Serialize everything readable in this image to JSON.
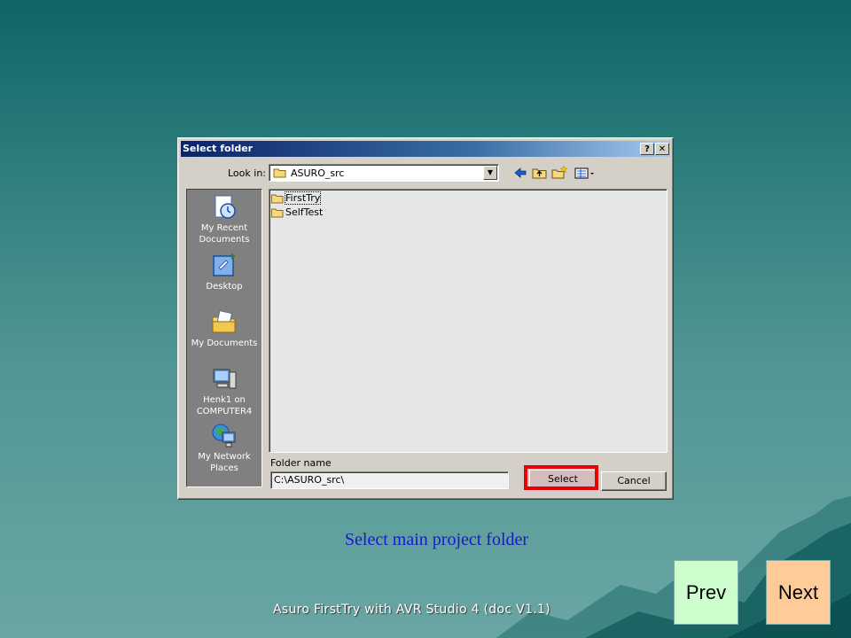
{
  "dialog": {
    "title": "Select folder",
    "help_btn": "?",
    "close_btn": "✕",
    "look_in_label": "Look in:",
    "look_in_value": "ASURO_src",
    "toolbar_icons": [
      "back-arrow-icon",
      "up-folder-icon",
      "new-folder-icon",
      "view-menu-icon"
    ],
    "places": [
      {
        "label": "My Recent Documents",
        "icon": "recent-documents-icon"
      },
      {
        "label": "Desktop",
        "icon": "desktop-icon"
      },
      {
        "label": "My Documents",
        "icon": "my-documents-icon"
      },
      {
        "label": "Henk1 on COMPUTER4",
        "icon": "computer-icon"
      },
      {
        "label": "My Network Places",
        "icon": "network-places-icon"
      }
    ],
    "files": [
      "FirstTry",
      "SelfTest"
    ],
    "folder_name_label": "Folder name",
    "folder_name_value": "C:\\ASURO_src\\",
    "select_btn": "Select",
    "cancel_btn": "Cancel"
  },
  "slide": {
    "caption": "Select main project folder",
    "footer": "Asuro FirstTry with AVR Studio 4 (doc V1.1)",
    "prev_label": "Prev",
    "next_label": "Next"
  },
  "colors": {
    "highlight": "#e60000",
    "caption": "#1a1acc",
    "prev_bg": "#ccffcc",
    "next_bg": "#ffcc99"
  }
}
